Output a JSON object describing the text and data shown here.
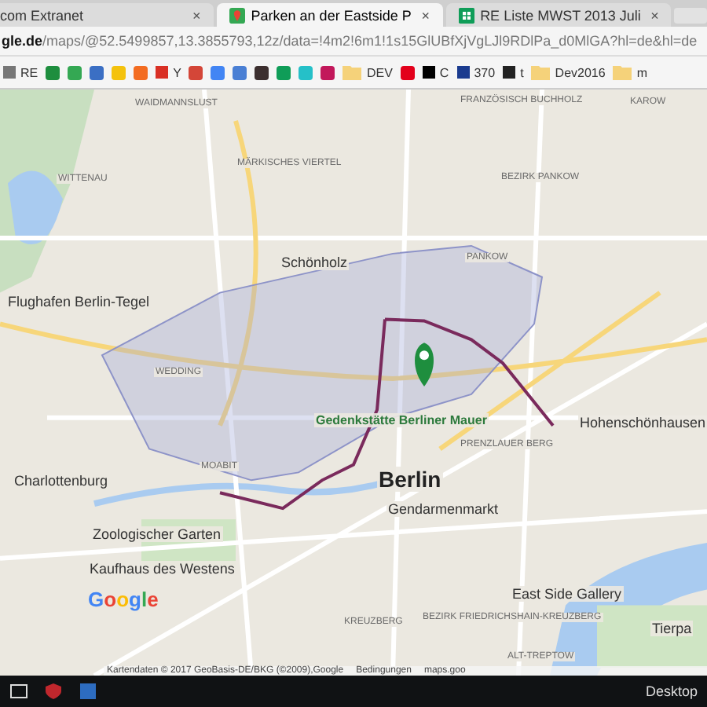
{
  "tabs": [
    {
      "title": "com Extranet",
      "selected": false,
      "close": "×"
    },
    {
      "title": "Parken an der Eastside P",
      "selected": true,
      "close": "×"
    },
    {
      "title": "RE Liste MWST 2013 Juli",
      "selected": false,
      "close": "×"
    }
  ],
  "address": {
    "host": "gle.de",
    "path": "/maps/@52.5499857,13.3855793,12z/data=!4m2!6m1!1s15GlUBfXjVgLJl9RDlPa_d0MlGA?hl=de&hl=de"
  },
  "bookmarks": [
    {
      "kind": "text",
      "label": "RE"
    },
    {
      "kind": "icon"
    },
    {
      "kind": "icon"
    },
    {
      "kind": "icon"
    },
    {
      "kind": "icon"
    },
    {
      "kind": "icon"
    },
    {
      "kind": "text",
      "label": "Y"
    },
    {
      "kind": "icon"
    },
    {
      "kind": "icon"
    },
    {
      "kind": "icon"
    },
    {
      "kind": "icon"
    },
    {
      "kind": "icon"
    },
    {
      "kind": "icon"
    },
    {
      "kind": "icon"
    },
    {
      "kind": "folder",
      "label": "DEV"
    },
    {
      "kind": "icon"
    },
    {
      "kind": "text",
      "label": "C"
    },
    {
      "kind": "text",
      "label": "370"
    },
    {
      "kind": "text",
      "label": "t"
    },
    {
      "kind": "folder",
      "label": "Dev2016"
    },
    {
      "kind": "folder",
      "label": "m"
    }
  ],
  "map": {
    "labels": [
      {
        "text": "WAIDMANNSLUST",
        "kind": "district"
      },
      {
        "text": "FRANZÖSISCH BUCHHOLZ",
        "kind": "district"
      },
      {
        "text": "KAROW",
        "kind": "district"
      },
      {
        "text": "MÄRKISCHES VIERTEL",
        "kind": "district"
      },
      {
        "text": "WITTENAU",
        "kind": "district"
      },
      {
        "text": "BEZIRK PANKOW",
        "kind": "district"
      },
      {
        "text": "Schönholz",
        "kind": "place"
      },
      {
        "text": "PANKOW",
        "kind": "district"
      },
      {
        "text": "Flughafen Berlin-Tegel",
        "kind": "place"
      },
      {
        "text": "WEDDING",
        "kind": "district"
      },
      {
        "text": "Gedenkstätte Berliner Mauer",
        "kind": "poi"
      },
      {
        "text": "Hohenschönhausen",
        "kind": "place"
      },
      {
        "text": "PRENZLAUER BERG",
        "kind": "district"
      },
      {
        "text": "MOABIT",
        "kind": "district"
      },
      {
        "text": "Charlottenburg",
        "kind": "place"
      },
      {
        "text": "Berlin",
        "kind": "city"
      },
      {
        "text": "Gendarmenmarkt",
        "kind": "place"
      },
      {
        "text": "Zoologischer Garten",
        "kind": "place"
      },
      {
        "text": "Kaufhaus des Westens",
        "kind": "place"
      },
      {
        "text": "East Side Gallery",
        "kind": "place"
      },
      {
        "text": "KREUZBERG",
        "kind": "district"
      },
      {
        "text": "BEZIRK FRIEDRICHSHAIN-KREUZBERG",
        "kind": "district"
      },
      {
        "text": "Tierpa",
        "kind": "place"
      },
      {
        "text": "ALT-TREPTOW",
        "kind": "district"
      }
    ],
    "logo": "Google",
    "attribution": "Kartendaten © 2017 GeoBasis-DE/BKG (©2009),Google",
    "terms": "Bedingungen",
    "url": "maps.goo"
  },
  "taskbar": {
    "desktop": "Desktop"
  }
}
